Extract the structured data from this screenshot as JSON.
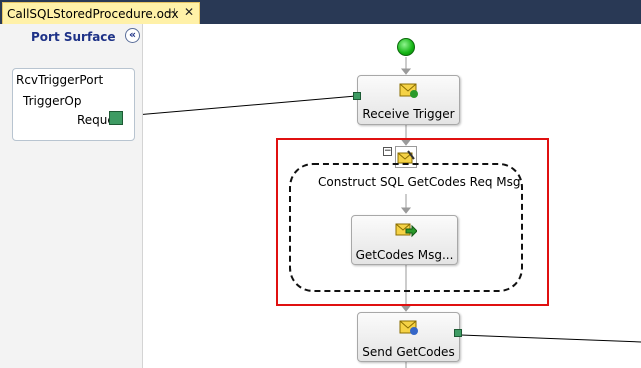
{
  "tab": {
    "title": "CallSQLStoredProcedure.odx",
    "pin_glyph": "⊣",
    "close_glyph": "✕"
  },
  "port_surface": {
    "title": "Port Surface",
    "collapse_glyph": "«",
    "port": {
      "name": "RcvTriggerPort",
      "operation": "TriggerOp",
      "message": "Request"
    }
  },
  "orchestration": {
    "receive_shape": {
      "label": "Receive Trigger",
      "icon": "receive-envelope-icon"
    },
    "scope": {
      "title": "Construct SQL GetCodes Req Msg",
      "collapse_glyph": "−",
      "icon": "construct-message-icon"
    },
    "assign_shape": {
      "label": "GetCodes  Msg...",
      "icon": "message-assignment-icon"
    },
    "send_shape": {
      "label": "Send GetCodes",
      "icon": "send-envelope-icon"
    }
  },
  "colors": {
    "tab_strip": "#293955",
    "active_tab": "#fff1a8",
    "selection_frame": "#e01010",
    "port_green": "#3e9b63",
    "start_green": "#14b414"
  }
}
